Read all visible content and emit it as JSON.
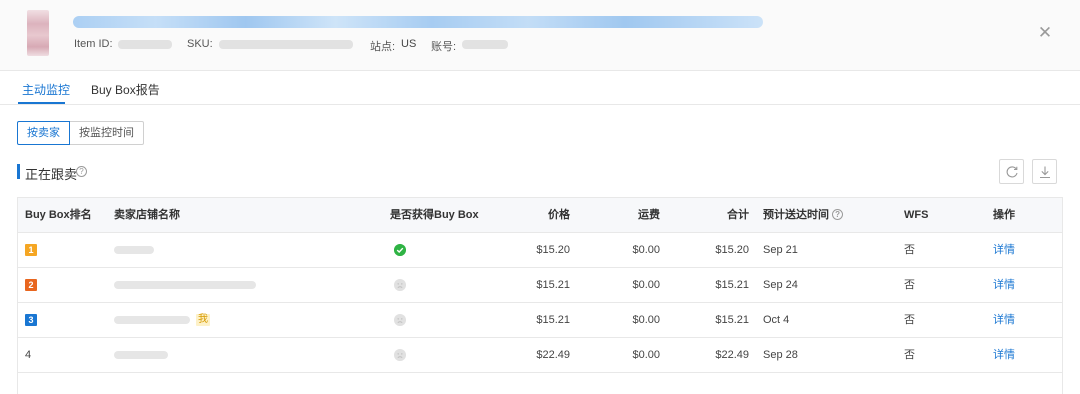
{
  "header": {
    "item_id_label": "Item ID:",
    "sku_label": "SKU:",
    "site_label": "站点:",
    "site_value": "US",
    "account_label": "账号:"
  },
  "tabs": [
    {
      "label": "主动监控",
      "active": true
    },
    {
      "label": "Buy Box报告",
      "active": false
    }
  ],
  "toggle": [
    {
      "label": "按卖家",
      "active": true
    },
    {
      "label": "按监控时间",
      "active": false
    }
  ],
  "section": {
    "title": "正在跟卖"
  },
  "table": {
    "columns": [
      "Buy Box排名",
      "卖家店铺名称",
      "是否获得Buy Box",
      "价格",
      "运费",
      "合计",
      "预计送达时间",
      "WFS",
      "操作"
    ],
    "rows": [
      {
        "rank": "1",
        "rank_color": "#f5a623",
        "is_me": false,
        "won_buy_box": true,
        "price": "$15.20",
        "shipping": "$0.00",
        "total": "$15.20",
        "delivery": "Sep 21",
        "wfs": "否",
        "action": "详情"
      },
      {
        "rank": "2",
        "rank_color": "#e8661f",
        "is_me": false,
        "won_buy_box": false,
        "price": "$15.21",
        "shipping": "$0.00",
        "total": "$15.21",
        "delivery": "Sep 24",
        "wfs": "否",
        "action": "详情"
      },
      {
        "rank": "3",
        "rank_color": "#1976d2",
        "is_me": true,
        "me_label": "我",
        "won_buy_box": false,
        "price": "$15.21",
        "shipping": "$0.00",
        "total": "$15.21",
        "delivery": "Oct 4",
        "wfs": "否",
        "action": "详情"
      },
      {
        "rank": "4",
        "rank_color": "",
        "is_me": false,
        "won_buy_box": false,
        "price": "$22.49",
        "shipping": "$0.00",
        "total": "$22.49",
        "delivery": "Sep 28",
        "wfs": "否",
        "action": "详情"
      }
    ]
  },
  "colors": {
    "accent": "#1976d2",
    "success": "#2fb344",
    "me_badge": "#d79b00"
  },
  "icons": [
    "close-icon",
    "help-icon",
    "refresh-icon",
    "download-icon",
    "check-circle-icon",
    "sad-face-icon"
  ]
}
